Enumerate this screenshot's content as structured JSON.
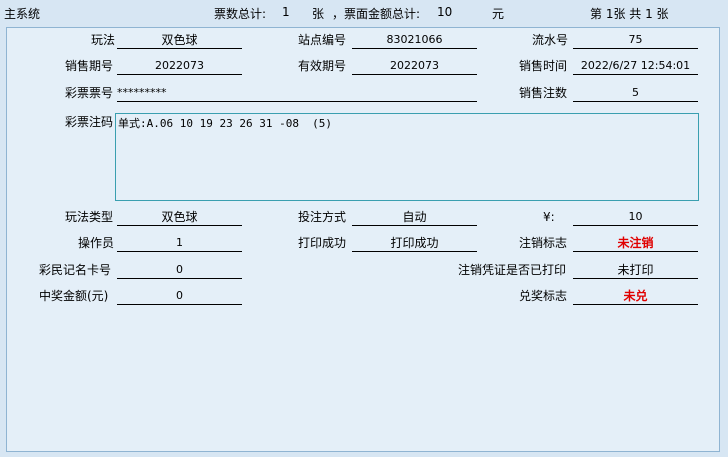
{
  "topbar": {
    "title": "主系统",
    "ticket_count_label": "票数总计:",
    "ticket_count": "1",
    "ticket_unit": "张",
    "amount_label": "，票面金额总计:",
    "amount": "10",
    "amount_unit": "元",
    "page_info": "第 1张  共 1 张"
  },
  "fields": {
    "play_method_label": "玩法",
    "play_method": "双色球",
    "station_label": "站点编号",
    "station": "83021066",
    "serial_label": "流水号",
    "serial": "75",
    "sale_period_label": "销售期号",
    "sale_period": "2022073",
    "valid_period_label": "有效期号",
    "valid_period": "2022073",
    "sale_time_label": "销售时间",
    "sale_time": "2022/6/27 12:54:01",
    "ticket_no_label": "彩票票号",
    "ticket_no": "*********",
    "sale_count_label": "销售注数",
    "sale_count": "5",
    "bet_code_label": "彩票注码",
    "bet_code": "单式:A.06 10 19 23 26 31 -08  (5)",
    "play_type_label": "玩法类型",
    "play_type": "双色球",
    "bet_mode_label": "投注方式",
    "bet_mode": "自动",
    "price_label": "¥:",
    "price": "10",
    "operator_label": "操作员",
    "operator": "1",
    "print_label": "打印成功",
    "print_value": "打印成功",
    "cancel_flag_label": "注销标志",
    "cancel_flag": "未注销",
    "card_label": "彩民记名卡号",
    "card": "0",
    "cancel_printed_label": "注销凭证是否已打印",
    "cancel_printed": "未打印",
    "prize_label": "中奖金额(元)",
    "prize": "0",
    "redeem_label": "兑奖标志",
    "redeem": "未兑"
  },
  "colors": {
    "background": "#d7e6f3",
    "panel": "#e4eff8",
    "alert_red": "#e00000",
    "textarea_border": "#3a9fb0"
  }
}
